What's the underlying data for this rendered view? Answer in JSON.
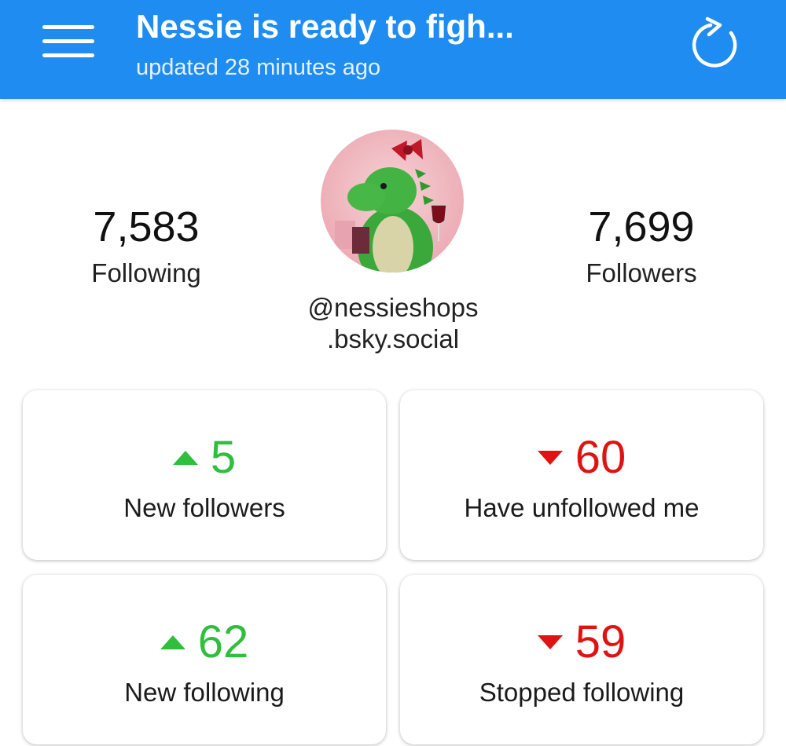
{
  "appbar": {
    "title": "Nessie is ready to figh...",
    "subtitle": "updated 28 minutes ago",
    "menu_icon": "hamburger-menu-icon",
    "refresh_icon": "refresh-icon",
    "color": "#1e8cf0"
  },
  "profile": {
    "following_count": "7,583",
    "following_label": "Following",
    "followers_count": "7,699",
    "followers_label": "Followers",
    "handle_line1": "@nessieshops",
    "handle_line2": ".bsky.social"
  },
  "cards": [
    {
      "value": "5",
      "label": "New followers",
      "trend": "up",
      "icon": "triangle-up-icon"
    },
    {
      "value": "60",
      "label": "Have unfollowed me",
      "trend": "down",
      "icon": "triangle-down-icon"
    },
    {
      "value": "62",
      "label": "New following",
      "trend": "up",
      "icon": "triangle-up-icon"
    },
    {
      "value": "59",
      "label": "Stopped following",
      "trend": "down",
      "icon": "triangle-down-icon"
    }
  ],
  "colors": {
    "up": "#2fbf3c",
    "down": "#e01212"
  }
}
